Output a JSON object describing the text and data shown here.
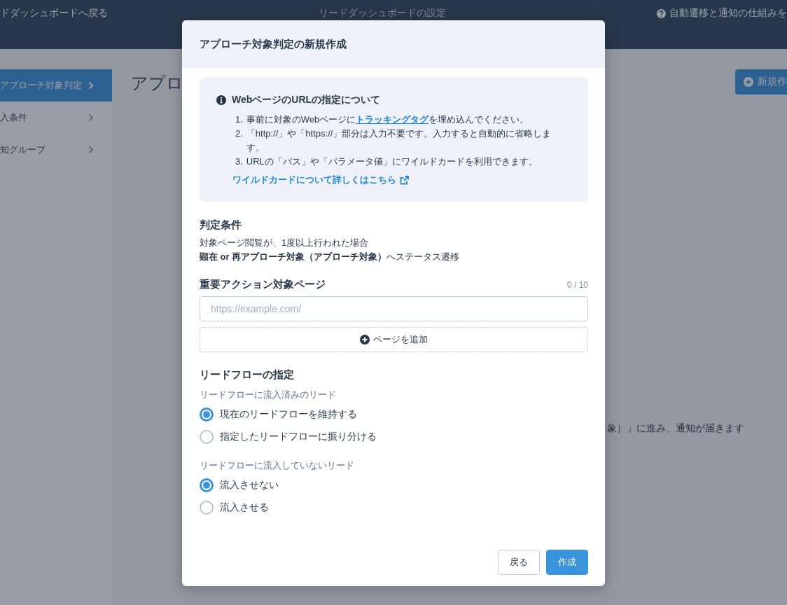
{
  "header": {
    "back_link": "ドダッシュボードへ戻る",
    "title": "リードダッシュボードの設定",
    "help_link": "自動遷移と通知の仕組みを"
  },
  "sidebar": {
    "items": [
      {
        "label": "アプローチ対象判定",
        "selected": true
      },
      {
        "label": "入条件",
        "selected": false
      },
      {
        "label": "知グループ",
        "selected": false
      }
    ]
  },
  "main": {
    "heading": "アプロ",
    "new_button": "新規作",
    "description": "象）」に進み、通知が届きます"
  },
  "dialog": {
    "title": "アプローチ対象判定の新規作成",
    "info": {
      "title": "WebページのURLの指定について",
      "items": [
        {
          "number": "1.",
          "parts": [
            {
              "kind": "text",
              "text": "事前に対象のWebページに"
            },
            {
              "kind": "link",
              "text": "トラッキングタグ"
            },
            {
              "kind": "text",
              "text": "を埋め込んでください。"
            }
          ]
        },
        {
          "number": "2.",
          "parts": [
            {
              "kind": "text",
              "text": "「http://」や「https://」部分は入力不要です。入力すると自動的に省略します。"
            }
          ]
        },
        {
          "number": "3.",
          "parts": [
            {
              "kind": "text",
              "text": "URLの「パス」や「パラメータ値」にワイルドカードを利用できます。"
            }
          ]
        }
      ],
      "more_link": "ワイルドカードについて詳しくはこちら"
    },
    "criteria": {
      "title": "判定条件",
      "lines": [
        "対象ページ閲覧が、1度以上行われた場合",
        "**顕在 or 再アプローチ対象（アプローチ対象）**へステータス遷移"
      ]
    },
    "pages": {
      "title": "重要アクション対象ページ",
      "counter": "0 / 10",
      "fields": [
        {
          "placeholder": "https://example.com/"
        }
      ],
      "add_button": "ページを追加"
    },
    "lead_flow": {
      "title": "リードフローの指定",
      "groups": [
        {
          "label": "リードフローに流入済みのリード",
          "options": [
            {
              "label": "現在のリードフローを維持する",
              "selected": true
            },
            {
              "label": "指定したリードフローに振り分ける",
              "selected": false
            }
          ]
        },
        {
          "label": "リードフローに流入していないリード",
          "options": [
            {
              "label": "流入させない",
              "selected": true
            },
            {
              "label": "流入させる",
              "selected": false
            }
          ]
        }
      ]
    },
    "buttons": [
      {
        "label": "戻る",
        "kind": "secondary"
      },
      {
        "label": "作成",
        "kind": "primary"
      }
    ]
  }
}
